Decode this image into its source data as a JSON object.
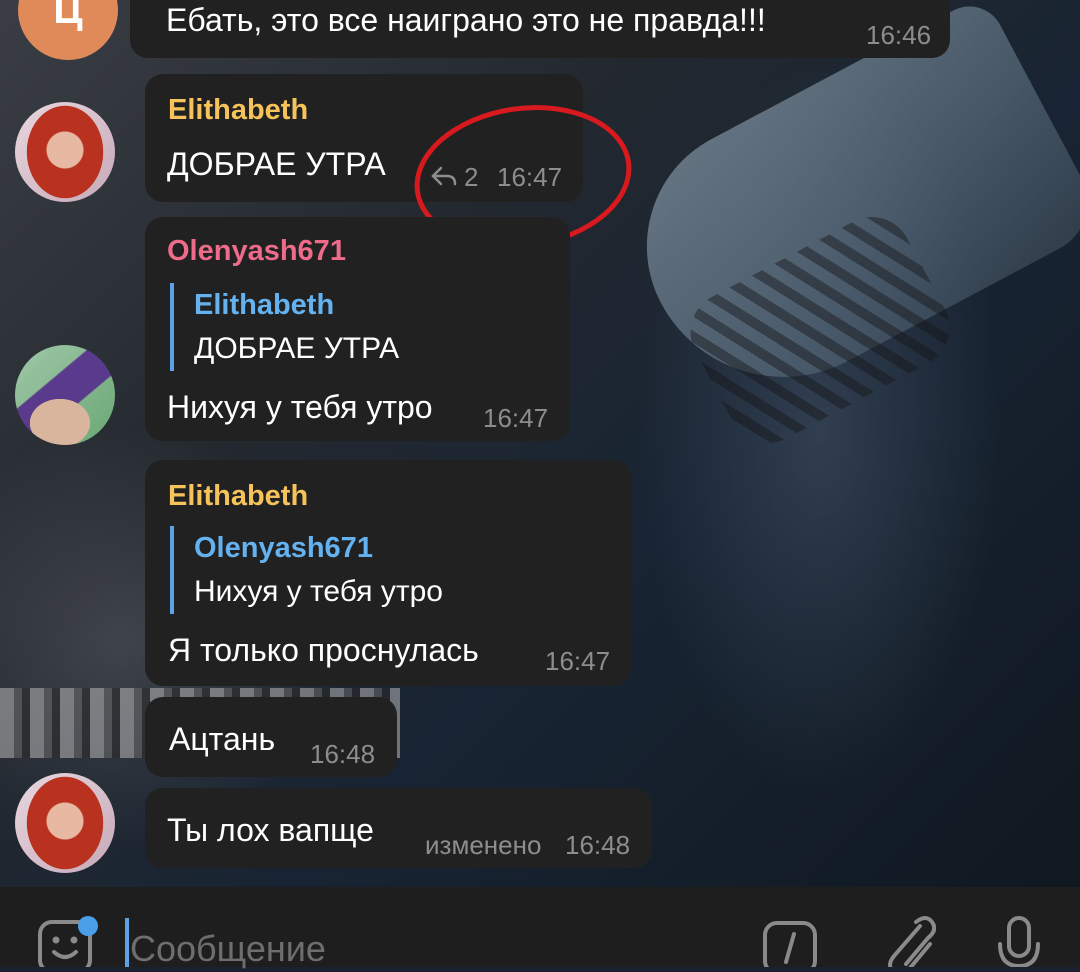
{
  "colors": {
    "bubble": "#212121",
    "name_elithabeth": "#f5c35a",
    "name_olenyash": "#ee6b8a",
    "quote_name": "#64b2f0",
    "time": "#8d8d8d",
    "annotation_circle": "#d81a1f",
    "input_bar": "#1e1e1e",
    "unread_dot": "#4a9fe8"
  },
  "messages": [
    {
      "avatar_letter": "Ц",
      "text": "Ебать, это все наиграно это не правда!!!",
      "time": "16:46"
    },
    {
      "author": "Elithabeth",
      "text": "ДОБРАЕ УТРА",
      "replies_count": "2",
      "time": "16:47"
    },
    {
      "author": "Olenyash671",
      "reply_to": {
        "author": "Elithabeth",
        "text": "ДОБРАЕ УТРА"
      },
      "text": "Нихуя у тебя утро",
      "time": "16:47"
    },
    {
      "author": "Elithabeth",
      "reply_to": {
        "author": "Olenyash671",
        "text": "Нихуя у тебя утро"
      },
      "text": "Я только проснулась",
      "time": "16:47"
    },
    {
      "text": "Ацтань",
      "time": "16:48"
    },
    {
      "text": "Ты лох вапще",
      "edited_label": "изменено",
      "time": "16:48"
    }
  ],
  "composer": {
    "placeholder": "Сообщение",
    "icons": [
      "sticker-icon",
      "bot-command-icon",
      "attach-icon",
      "microphone-icon"
    ]
  }
}
